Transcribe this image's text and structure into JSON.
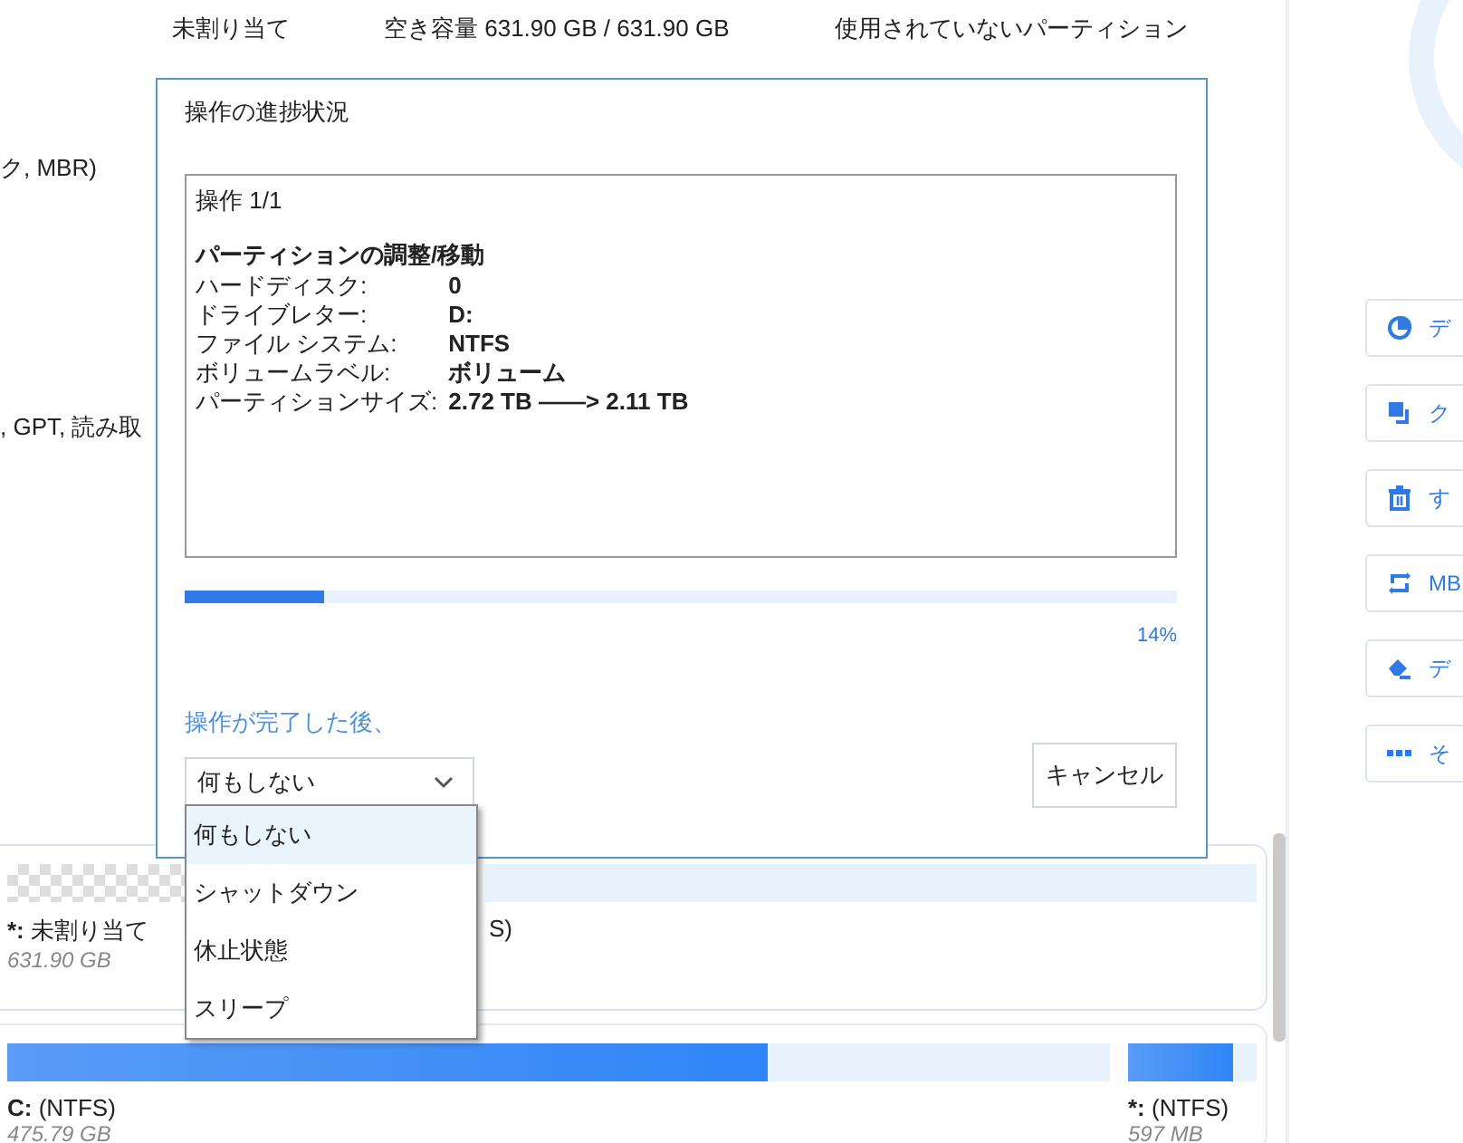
{
  "partition_row": {
    "name": "未割り当て",
    "capacity": "空き容量 631.90 GB / 631.90 GB",
    "type": "使用されていないパーティション"
  },
  "disk_labels": [
    "ク, MBR)",
    ", GPT, 読み取"
  ],
  "disks": [
    {
      "partitions": [
        {
          "kind": "unallocated",
          "letter": "*:",
          "fs": "未割り当て",
          "size": "631.90 GB"
        },
        {
          "kind": "partition",
          "fs": "S)"
        }
      ]
    },
    {
      "partitions": [
        {
          "kind": "partition",
          "letter": "C:",
          "fs": "(NTFS)",
          "size": "475.79 GB",
          "level": 0.69
        },
        {
          "kind": "partition",
          "letter": "*:",
          "fs": "(NTFS)",
          "size": "597 MB",
          "level": 0.82
        }
      ]
    }
  ],
  "actions": [
    {
      "kind": "pie",
      "label": "デ"
    },
    {
      "kind": "clone",
      "label": "ク"
    },
    {
      "kind": "trash",
      "label": "す"
    },
    {
      "kind": "convert",
      "label": "MB"
    },
    {
      "kind": "eraser",
      "label": "デ"
    },
    {
      "kind": "more",
      "label": "そ"
    }
  ],
  "dialog": {
    "title": "操作の進捗状況",
    "log": {
      "header": "操作 1/1",
      "operation": "パーティションの調整/移動",
      "fields": [
        {
          "label": "ハードディスク:",
          "value": "0"
        },
        {
          "label": "ドライブレター:",
          "value": "D:"
        },
        {
          "label": "ファイル システム:",
          "value": "NTFS"
        },
        {
          "label": "ボリュームラベル:",
          "value": "ボリューム"
        },
        {
          "label": "パーティションサイズ:",
          "value": "2.72 TB ——> 2.11 TB"
        }
      ]
    },
    "progress": {
      "level": 0.14,
      "reading": "14%"
    },
    "after_label": "操作が完了した後、",
    "after_select": {
      "value": "何もしない",
      "expanded": true,
      "options": [
        {
          "label": "何もしない",
          "selected": true
        },
        {
          "label": "シャットダウン",
          "selected": false
        },
        {
          "label": "休止状態",
          "selected": false
        },
        {
          "label": "スリープ",
          "selected": false
        }
      ]
    },
    "cancel": "キャンセル"
  }
}
